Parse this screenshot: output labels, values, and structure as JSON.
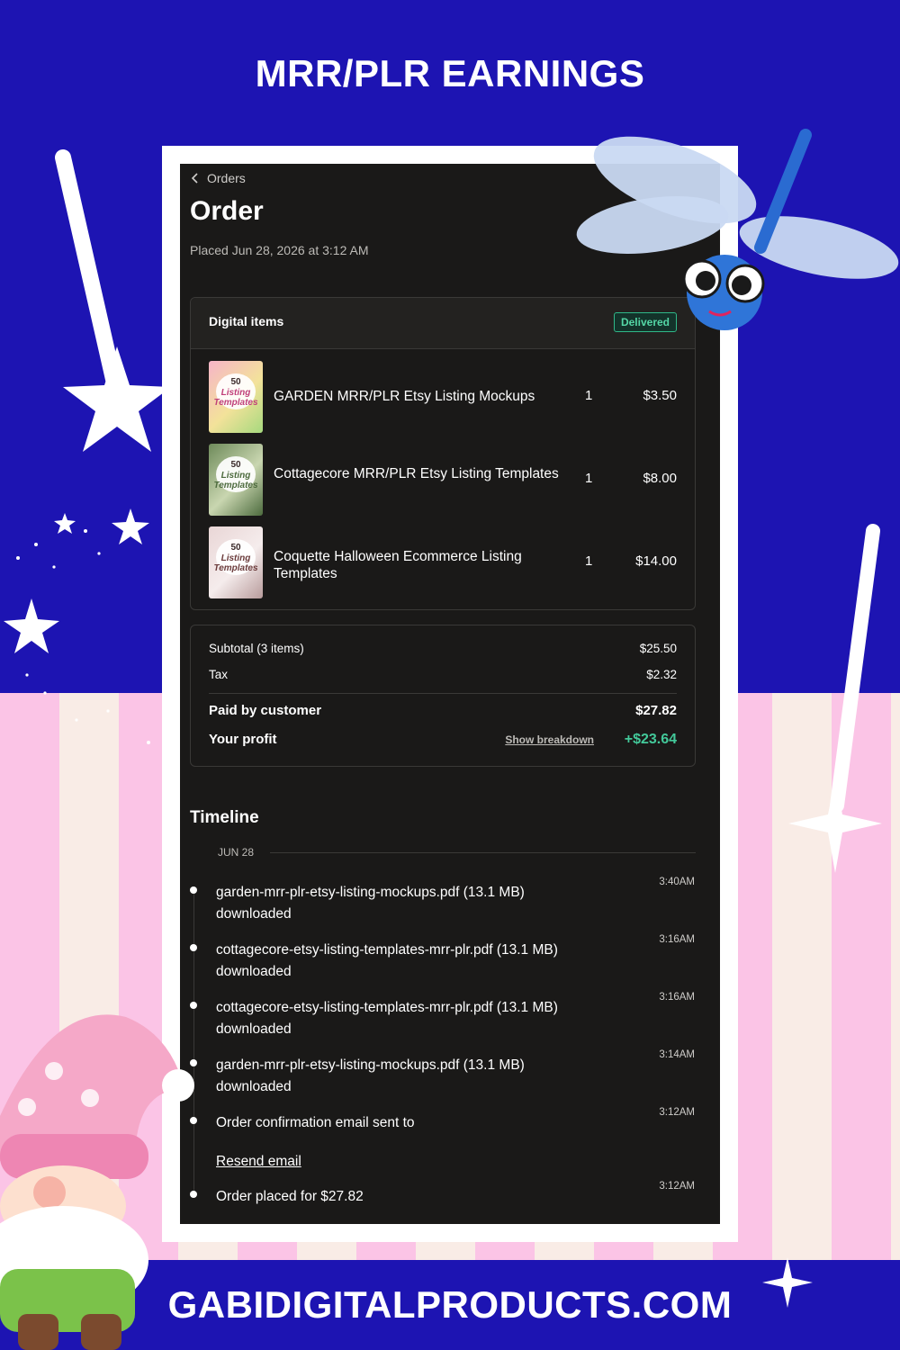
{
  "banner": {
    "headline": "MRR/PLR EARNINGS",
    "footer": "GABIDIGITALPRODUCTS.COM"
  },
  "order": {
    "back_label": "Orders",
    "title": "Order",
    "placed": "Placed Jun 28, 2026 at 3:12 AM"
  },
  "digital_items": {
    "heading": "Digital items",
    "status": "Delivered",
    "items": [
      {
        "name": "GARDEN MRR/PLR Etsy Listing Mockups",
        "qty": "1",
        "price": "$3.50"
      },
      {
        "name": "Cottagecore MRR/PLR Etsy Listing Templates",
        "qty": "1",
        "price": "$8.00"
      },
      {
        "name": "Coquette Halloween Ecommerce Listing Templates",
        "qty": "1",
        "price": "$14.00"
      }
    ],
    "thumb_text": {
      "number": "50",
      "script": "Listing Templates"
    }
  },
  "summary": {
    "subtotal_label": "Subtotal (3 items)",
    "subtotal_value": "$25.50",
    "tax_label": "Tax",
    "tax_value": "$2.32",
    "paid_label": "Paid by customer",
    "paid_value": "$27.82",
    "profit_label": "Your profit",
    "breakdown_link": "Show breakdown",
    "profit_value": "+$23.64"
  },
  "timeline": {
    "title": "Timeline",
    "date": "JUN 28",
    "events": [
      {
        "text": "garden-mrr-plr-etsy-listing-mockups.pdf (13.1 MB) downloaded",
        "time": "3:40AM"
      },
      {
        "text": "cottagecore-etsy-listing-templates-mrr-plr.pdf (13.1 MB) downloaded",
        "time": "3:16AM"
      },
      {
        "text": "cottagecore-etsy-listing-templates-mrr-plr.pdf (13.1 MB) downloaded",
        "time": "3:16AM"
      },
      {
        "text": "garden-mrr-plr-etsy-listing-mockups.pdf (13.1 MB) downloaded",
        "time": "3:14AM"
      },
      {
        "text": "Order confirmation email sent to",
        "time": "3:12AM"
      },
      {
        "text": "Order placed for $27.82",
        "time": "3:12AM"
      }
    ],
    "resend_label": "Resend email"
  },
  "colors": {
    "banner_blue": "#1d14b2",
    "stripe_pink": "#fbc4e6",
    "stripe_cream": "#f9ece6",
    "screen_bg": "#1a1918",
    "profit_green": "#43c99a"
  },
  "icons": [
    "chevron-left-icon",
    "magic-wand-icon",
    "sparkle-star-icon",
    "dragonfly-illustration",
    "gnome-illustration"
  ]
}
